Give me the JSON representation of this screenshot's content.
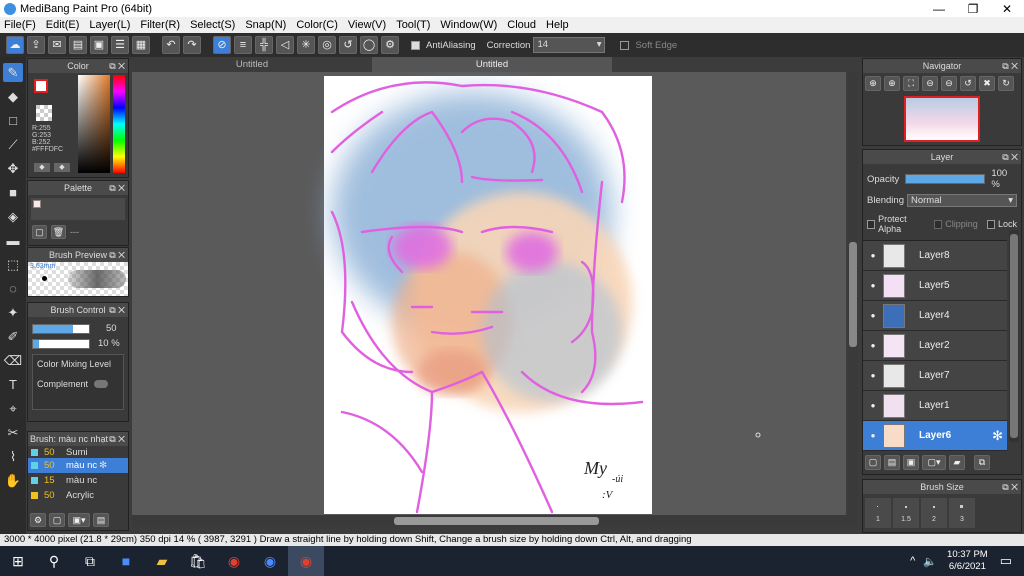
{
  "window": {
    "title": "MediBang Paint Pro (64bit)",
    "minimize": "—",
    "maximize": "❐",
    "close": "✕"
  },
  "menu": [
    "File(F)",
    "Edit(E)",
    "Layer(L)",
    "Filter(R)",
    "Select(S)",
    "Snap(N)",
    "Color(C)",
    "View(V)",
    "Tool(T)",
    "Window(W)",
    "Cloud",
    "Help"
  ],
  "toolbar": {
    "antialiasing_label": "AntiAliasing",
    "correction_label": "Correction",
    "correction_value": "14",
    "soft_edge_label": "Soft Edge"
  },
  "tabs": [
    {
      "label": "Untitled"
    },
    {
      "label": "Untitled"
    }
  ],
  "color_panel": {
    "title": "Color",
    "r": "R:255",
    "g": "G:253",
    "b": "B:252",
    "hex": "#FFFDFC"
  },
  "palette_panel": {
    "title": "Palette",
    "dash": "---"
  },
  "brush_preview": {
    "title": "Brush Preview",
    "size": "3.63mm"
  },
  "brush_control": {
    "title": "Brush Control",
    "size_value": "50",
    "opacity_value": "10 %",
    "color_mixing": "Color Mixing Level",
    "complement": "Complement"
  },
  "brush_list": {
    "title": "Brush: màu nc nhạt",
    "items": [
      {
        "size": "50",
        "name": "Sumi"
      },
      {
        "size": "50",
        "name": "màu nc",
        "selected": true
      },
      {
        "size": "15",
        "name": "màu nc"
      },
      {
        "size": "50",
        "name": "Acrylic"
      }
    ]
  },
  "navigator": {
    "title": "Navigator"
  },
  "layer_panel": {
    "title": "Layer",
    "opacity_label": "Opacity",
    "opacity_value": "100 %",
    "opacity_level": 1.0,
    "blending_label": "Blending",
    "blending_value": "Normal",
    "protect_alpha": "Protect Alpha",
    "clipping": "Clipping",
    "lock": "Lock",
    "layers": [
      {
        "name": "Layer8"
      },
      {
        "name": "Layer5"
      },
      {
        "name": "Layer4"
      },
      {
        "name": "Layer2"
      },
      {
        "name": "Layer7"
      },
      {
        "name": "Layer1"
      },
      {
        "name": "Layer6",
        "selected": true
      }
    ]
  },
  "brush_size": {
    "title": "Brush Size",
    "sizes": [
      "1",
      "1.5",
      "2",
      "3"
    ]
  },
  "status": "3000 * 4000 pixel  (21.8 * 29cm)  350 dpi   14 %  ( 3987, 3291 )  Draw a straight line by holding down Shift, Change a brush size by holding down Ctrl, Alt, and dragging",
  "taskbar": {
    "time": "10:37 PM",
    "date": "6/6/2021"
  },
  "signature": "My-úi :V",
  "colors": {
    "accent": "#3d7fd6",
    "stroke": "#e060e0"
  }
}
